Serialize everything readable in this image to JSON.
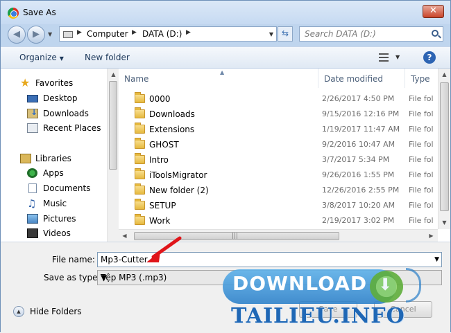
{
  "window": {
    "title": "Save As",
    "close_glyph": "✕"
  },
  "nav": {
    "back_glyph": "◀",
    "forward_glyph": "▶",
    "breadcrumb": [
      "Computer",
      "DATA (D:)"
    ],
    "refresh_glyph": "⇆",
    "search_placeholder": "Search DATA (D:)"
  },
  "toolbar": {
    "organize_label": "Organize",
    "new_folder_label": "New folder",
    "help_glyph": "?"
  },
  "sidebar": {
    "items": [
      {
        "label": "Favorites",
        "icon": "star-icon",
        "group": true
      },
      {
        "label": "Desktop",
        "icon": "desktop-icon"
      },
      {
        "label": "Downloads",
        "icon": "downloads-icon"
      },
      {
        "label": "Recent Places",
        "icon": "recent-places-icon"
      },
      {
        "label": "Libraries",
        "icon": "library-icon",
        "group": true
      },
      {
        "label": "Apps",
        "icon": "apps-icon"
      },
      {
        "label": "Documents",
        "icon": "documents-icon"
      },
      {
        "label": "Music",
        "icon": "music-icon"
      },
      {
        "label": "Pictures",
        "icon": "pictures-icon"
      },
      {
        "label": "Videos",
        "icon": "videos-icon"
      }
    ]
  },
  "file_list": {
    "columns": [
      "Name",
      "Date modified",
      "Type"
    ],
    "rows": [
      {
        "name": "0000",
        "date": "2/26/2017 4:50 PM",
        "type": "File fol"
      },
      {
        "name": "Downloads",
        "date": "9/15/2016 12:16 PM",
        "type": "File fol"
      },
      {
        "name": "Extensions",
        "date": "1/19/2017 11:47 AM",
        "type": "File fol"
      },
      {
        "name": "GHOST",
        "date": "9/2/2016 10:47 AM",
        "type": "File fol"
      },
      {
        "name": "Intro",
        "date": "3/7/2017 5:34 PM",
        "type": "File fol"
      },
      {
        "name": "iToolsMigrator",
        "date": "9/26/2016 1:55 PM",
        "type": "File fol"
      },
      {
        "name": "New folder (2)",
        "date": "12/26/2016 2:55 PM",
        "type": "File fol"
      },
      {
        "name": "SETUP",
        "date": "3/8/2017 10:20 AM",
        "type": "File fol"
      },
      {
        "name": "Work",
        "date": "2/19/2017 3:02 PM",
        "type": "File fol"
      }
    ]
  },
  "form": {
    "file_name_label": "File name:",
    "file_name_value": "Mp3-Cutter",
    "save_as_type_label": "Save as type:",
    "save_as_type_value": "Tệp MP3 (.mp3)",
    "hide_folders_label": "Hide Folders",
    "save_button": "Save",
    "cancel_button": "Cancel"
  },
  "watermark": {
    "download_text": "DOWNLOAD",
    "site_text": "TAILIEU.INFO"
  },
  "colors": {
    "accent": "#2d64b3",
    "annotation_arrow": "#e0151a",
    "watermark_blue": "#1f67b5"
  }
}
